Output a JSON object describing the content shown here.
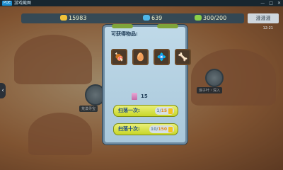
{
  "titlebar": {
    "logo": "POE",
    "title": "游戏截图",
    "minimize": "—",
    "maximize": "□",
    "close": "✕"
  },
  "resources": {
    "gold": "15983",
    "gems": "639",
    "energy": "300/200"
  },
  "top_right": {
    "badge": "灌灌灌",
    "sub": "12:21"
  },
  "map": {
    "node_right_label": "浪子叶・深入",
    "node_left_label": "荒漠寻宝"
  },
  "dialog": {
    "title": "可获得物品:",
    "items": [
      {
        "icon": "meat-icon",
        "glyph": "🍖"
      },
      {
        "icon": "egg-icon",
        "glyph": "🥚"
      },
      {
        "icon": "crystal-icon",
        "glyph": "💠"
      },
      {
        "icon": "bone-icon",
        "glyph": "🦴"
      }
    ],
    "ticket_count": "15",
    "sweep_once": {
      "label": "扫荡一次:",
      "have": "1",
      "need": "15"
    },
    "sweep_ten": {
      "label": "扫荡十次:",
      "have": "10",
      "need": "150"
    }
  },
  "colors": {
    "button": "#dbe44a",
    "panel": "#b3d0e0",
    "accent": "#1d4a8a"
  }
}
